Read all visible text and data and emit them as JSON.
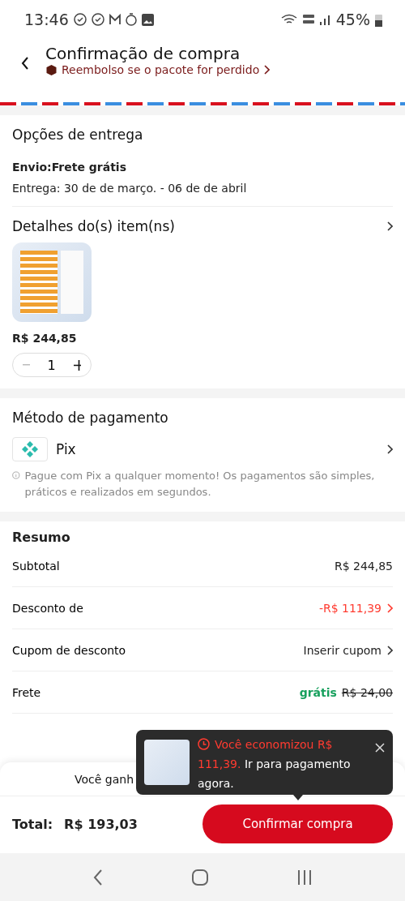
{
  "status_bar": {
    "time": "13:46",
    "battery": "45%"
  },
  "header": {
    "title": "Confirmação de compra",
    "refund_link": "Reembolso se o pacote for perdido"
  },
  "delivery": {
    "title": "Opções de entrega",
    "shipping": "Envio:Frete grátis",
    "estimate": "Entrega: 30 de de março. - 06 de de abril"
  },
  "items": {
    "title": "Detalhes do(s) item(ns)",
    "price": "R$ 244,85",
    "quantity": "1"
  },
  "payment": {
    "title": "Método de pagamento",
    "method": "Pix",
    "note": "Pague com Pix a qualquer momento! Os pagamentos são simples, práticos e realizados em segundos."
  },
  "summary": {
    "title": "Resumo",
    "rows": [
      {
        "label": "Subtotal",
        "kind": "plain",
        "value": "R$ 244,85"
      },
      {
        "label": "Desconto de",
        "kind": "discount",
        "value": "-R$ 111,39"
      },
      {
        "label": "Cupom de desconto",
        "kind": "link",
        "value": "Inserir cupom"
      },
      {
        "label": "Frete",
        "kind": "free",
        "free": "grátis",
        "value": "R$ 24,00"
      }
    ]
  },
  "credits_banner": {
    "left": "Você ganh"
  },
  "footer": {
    "total_label": "Total:",
    "total": "R$ 193,03",
    "confirm": "Confirmar compra"
  },
  "toast": {
    "highlight": "Você economizou R$ 111,39.",
    "text": "Ir para pagamento agora."
  }
}
